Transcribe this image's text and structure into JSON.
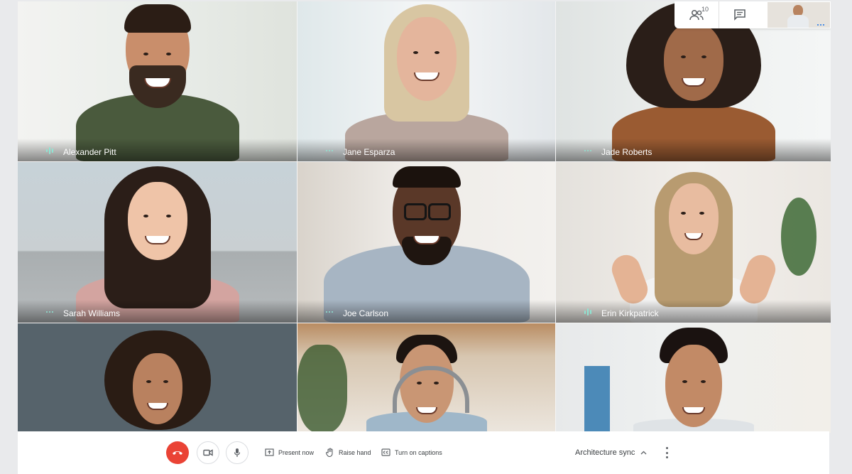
{
  "participants_count": "10",
  "tiles": [
    {
      "name": "Alexander Pitt",
      "speaking": true
    },
    {
      "name": "Jane Esparza",
      "speaking": false
    },
    {
      "name": "Jade Roberts",
      "speaking": false
    },
    {
      "name": "Sarah Williams",
      "speaking": false
    },
    {
      "name": "Joe Carlson",
      "speaking": false
    },
    {
      "name": "Erin Kirkpatrick",
      "speaking": true
    },
    {
      "name": "",
      "speaking": false
    },
    {
      "name": "",
      "speaking": false
    },
    {
      "name": "",
      "speaking": false
    }
  ],
  "controls": {
    "present_label": "Present now",
    "raise_hand_label": "Raise hand",
    "captions_label": "Turn on captions",
    "meeting_name": "Architecture sync"
  },
  "colors": {
    "end_call": "#ea4335",
    "speaking_indicator": "#8ee5d3",
    "accent_text": "#3c4043"
  },
  "icons": [
    "people-icon",
    "chat-icon",
    "end-call-icon",
    "camera-icon",
    "microphone-icon",
    "present-icon",
    "raise-hand-icon",
    "captions-icon",
    "chevron-up-icon",
    "more-vert-icon"
  ]
}
